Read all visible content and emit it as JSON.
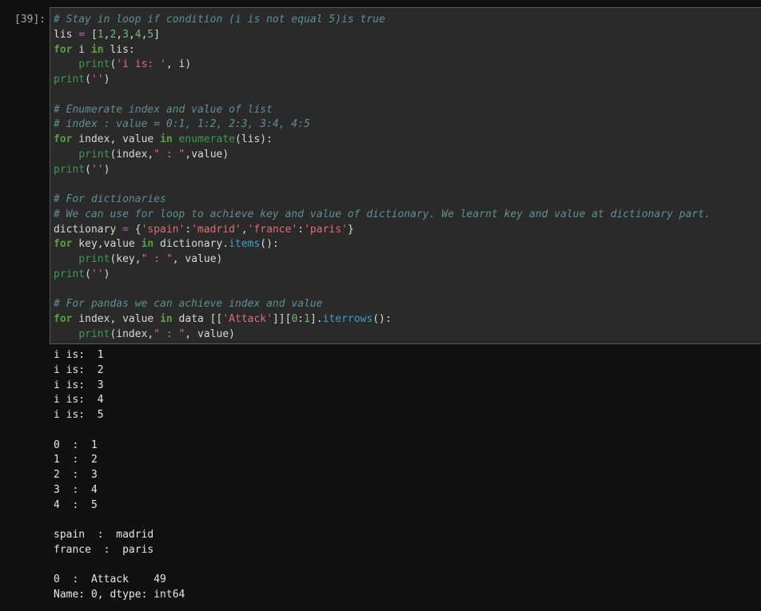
{
  "cell": {
    "prompt": "[39]:",
    "code_lines": [
      [
        {
          "t": "# Stay in loop if condition (i is not equal 5)is true",
          "c": "cm"
        }
      ],
      [
        {
          "t": "lis ",
          "c": "tx"
        },
        {
          "t": "=",
          "c": "op"
        },
        {
          "t": " [",
          "c": "tx"
        },
        {
          "t": "1",
          "c": "nu"
        },
        {
          "t": ",",
          "c": "tx"
        },
        {
          "t": "2",
          "c": "nu"
        },
        {
          "t": ",",
          "c": "tx"
        },
        {
          "t": "3",
          "c": "nu"
        },
        {
          "t": ",",
          "c": "tx"
        },
        {
          "t": "4",
          "c": "nu"
        },
        {
          "t": ",",
          "c": "tx"
        },
        {
          "t": "5",
          "c": "nu"
        },
        {
          "t": "]",
          "c": "tx"
        }
      ],
      [
        {
          "t": "for",
          "c": "kw"
        },
        {
          "t": " i ",
          "c": "tx"
        },
        {
          "t": "in",
          "c": "kw"
        },
        {
          "t": " lis:",
          "c": "tx"
        }
      ],
      [
        {
          "t": "    ",
          "c": "tx"
        },
        {
          "t": "print",
          "c": "fn"
        },
        {
          "t": "(",
          "c": "tx"
        },
        {
          "t": "'i is: '",
          "c": "st"
        },
        {
          "t": ", i)",
          "c": "tx"
        }
      ],
      [
        {
          "t": "print",
          "c": "fn"
        },
        {
          "t": "(",
          "c": "tx"
        },
        {
          "t": "''",
          "c": "st"
        },
        {
          "t": ")",
          "c": "tx"
        }
      ],
      [],
      [
        {
          "t": "# Enumerate index and value of list",
          "c": "cm"
        }
      ],
      [
        {
          "t": "# index : value = 0:1, 1:2, 2:3, 3:4, 4:5",
          "c": "cm"
        }
      ],
      [
        {
          "t": "for",
          "c": "kw"
        },
        {
          "t": " index, value ",
          "c": "tx"
        },
        {
          "t": "in",
          "c": "kw"
        },
        {
          "t": " ",
          "c": "tx"
        },
        {
          "t": "enumerate",
          "c": "fn"
        },
        {
          "t": "(lis):",
          "c": "tx"
        }
      ],
      [
        {
          "t": "    ",
          "c": "tx"
        },
        {
          "t": "print",
          "c": "fn"
        },
        {
          "t": "(index,",
          "c": "tx"
        },
        {
          "t": "\" : \"",
          "c": "st"
        },
        {
          "t": ",value)",
          "c": "tx"
        }
      ],
      [
        {
          "t": "print",
          "c": "fn"
        },
        {
          "t": "(",
          "c": "tx"
        },
        {
          "t": "''",
          "c": "st"
        },
        {
          "t": ")",
          "c": "tx"
        }
      ],
      [],
      [
        {
          "t": "# For dictionaries",
          "c": "cm"
        }
      ],
      [
        {
          "t": "# We can use for loop to achieve key and value of dictionary. We learnt key and value at dictionary part.",
          "c": "cm"
        }
      ],
      [
        {
          "t": "dictionary ",
          "c": "tx"
        },
        {
          "t": "=",
          "c": "op"
        },
        {
          "t": " {",
          "c": "tx"
        },
        {
          "t": "'spain'",
          "c": "st"
        },
        {
          "t": ":",
          "c": "tx"
        },
        {
          "t": "'madrid'",
          "c": "st"
        },
        {
          "t": ",",
          "c": "tx"
        },
        {
          "t": "'france'",
          "c": "st"
        },
        {
          "t": ":",
          "c": "tx"
        },
        {
          "t": "'paris'",
          "c": "st"
        },
        {
          "t": "}",
          "c": "tx"
        }
      ],
      [
        {
          "t": "for",
          "c": "kw"
        },
        {
          "t": " key,value ",
          "c": "tx"
        },
        {
          "t": "in",
          "c": "kw"
        },
        {
          "t": " dictionary.",
          "c": "tx"
        },
        {
          "t": "items",
          "c": "at"
        },
        {
          "t": "():",
          "c": "tx"
        }
      ],
      [
        {
          "t": "    ",
          "c": "tx"
        },
        {
          "t": "print",
          "c": "fn"
        },
        {
          "t": "(key,",
          "c": "tx"
        },
        {
          "t": "\" : \"",
          "c": "st"
        },
        {
          "t": ", value)",
          "c": "tx"
        }
      ],
      [
        {
          "t": "print",
          "c": "fn"
        },
        {
          "t": "(",
          "c": "tx"
        },
        {
          "t": "''",
          "c": "st"
        },
        {
          "t": ")",
          "c": "tx"
        }
      ],
      [],
      [
        {
          "t": "# For pandas we can achieve index and value",
          "c": "cm"
        }
      ],
      [
        {
          "t": "for",
          "c": "kw"
        },
        {
          "t": " index, value ",
          "c": "tx"
        },
        {
          "t": "in",
          "c": "kw"
        },
        {
          "t": " data [[",
          "c": "tx"
        },
        {
          "t": "'Attack'",
          "c": "st"
        },
        {
          "t": "]][",
          "c": "tx"
        },
        {
          "t": "0",
          "c": "nu"
        },
        {
          "t": ":",
          "c": "tx"
        },
        {
          "t": "1",
          "c": "nu"
        },
        {
          "t": "].",
          "c": "tx"
        },
        {
          "t": "iterrows",
          "c": "at"
        },
        {
          "t": "():",
          "c": "tx"
        }
      ],
      [
        {
          "t": "    ",
          "c": "tx"
        },
        {
          "t": "print",
          "c": "fn"
        },
        {
          "t": "(index,",
          "c": "tx"
        },
        {
          "t": "\" : \"",
          "c": "st"
        },
        {
          "t": ", value)",
          "c": "tx"
        }
      ]
    ],
    "output_lines": [
      "i is:  1",
      "i is:  2",
      "i is:  3",
      "i is:  4",
      "i is:  5",
      "",
      "0  :  1",
      "1  :  2",
      "2  :  3",
      "3  :  4",
      "4  :  5",
      "",
      "spain  :  madrid",
      "france  :  paris",
      "",
      "0  :  Attack    49",
      "Name: 0, dtype: int64"
    ]
  },
  "colors": {
    "background": "#111111",
    "cell_background": "#2a2a2a",
    "comment": "#5f8f93",
    "keyword": "#5aa23c",
    "builtin": "#3f9a4f",
    "string": "#e06c75",
    "number": "#6fb86f",
    "operator": "#b866b8",
    "attribute": "#3aa0c7"
  }
}
